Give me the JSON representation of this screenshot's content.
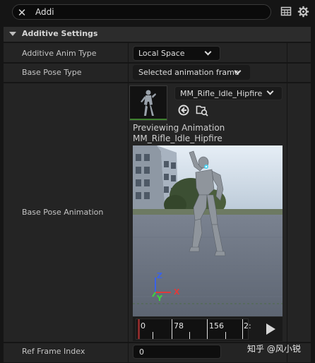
{
  "search": {
    "value": "Addi"
  },
  "category": {
    "label": "Additive Settings"
  },
  "rows": {
    "additive_anim_type": {
      "label": "Additive Anim Type",
      "value": "Local Space"
    },
    "base_pose_type": {
      "label": "Base Pose Type",
      "value": "Selected animation frame"
    },
    "base_pose_animation": {
      "label": "Base Pose Animation",
      "asset": "MM_Rifle_Idle_Hipfire",
      "preview_line1": "Previewing Animation",
      "preview_line2": "MM_Rifle_Idle_Hipfire"
    },
    "ref_frame_index": {
      "label": "Ref Frame Index",
      "value": "0"
    }
  },
  "timeline": {
    "ticks": [
      "0",
      "78",
      "156",
      "2:"
    ]
  },
  "axes": {
    "x": "X",
    "y": "Y",
    "z": "Z"
  },
  "watermark": "知乎 @风小锐",
  "colors": {
    "background": "#151515",
    "row": "#242424",
    "header": "#2c2c2c",
    "axis_x": "#e03a3a",
    "axis_y": "#3adb3a",
    "axis_z": "#3a62e8",
    "thumb_bar": "#3e7f2e",
    "playhead": "#8a2b2b"
  },
  "icons": {
    "clear": "close-icon",
    "table": "table-view-icon",
    "settings": "gear-icon",
    "browse": "use-selected-asset-icon",
    "find": "browse-to-asset-icon",
    "play": "play-icon"
  }
}
